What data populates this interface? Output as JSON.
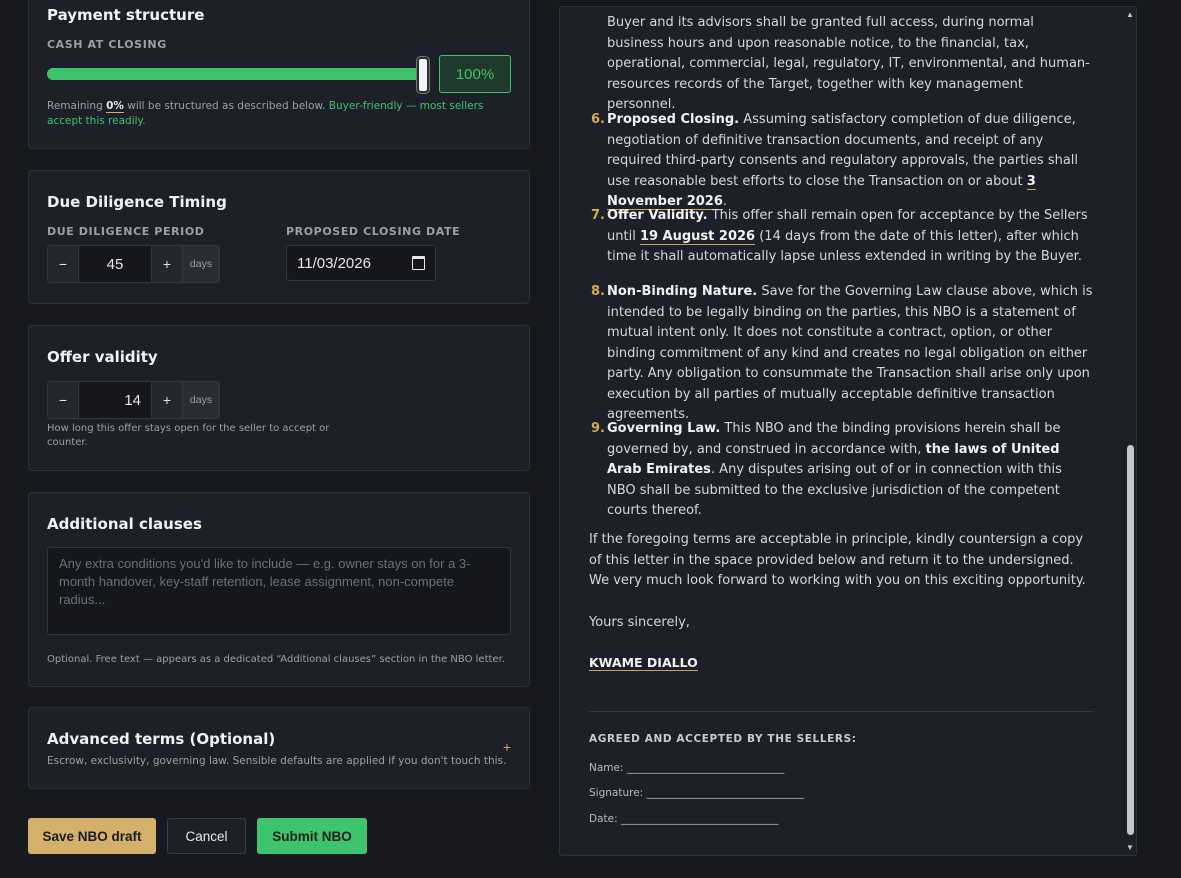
{
  "payment": {
    "title": "Payment structure",
    "cash_label": "CASH AT CLOSING",
    "cash_percent_display": "100%",
    "cash_percent": 100,
    "remaining_prefix": "Remaining ",
    "remaining_value": "0%",
    "remaining_suffix": " will be structured as described below. ",
    "remaining_hint": "Buyer-friendly — most sellers accept this readily."
  },
  "due_diligence": {
    "title": "Due Diligence Timing",
    "period_label": "DUE DILIGENCE PERIOD",
    "period_value": "45",
    "period_unit": "days",
    "minus": "−",
    "plus": "+",
    "closing_label": "PROPOSED CLOSING DATE",
    "closing_value": "11/03/2026"
  },
  "offer_validity": {
    "title": "Offer validity",
    "value": "14",
    "unit": "days",
    "minus": "−",
    "plus": "+",
    "help": "How long this offer stays open for the seller to accept or counter."
  },
  "additional": {
    "title": "Additional clauses",
    "placeholder": "Any extra conditions you'd like to include — e.g. owner stays on for a 3-month handover, key-staff retention, lease assignment, non-compete radius...",
    "help": "Optional. Free text — appears as a dedicated “Additional clauses” section in the NBO letter."
  },
  "advanced": {
    "title": "Advanced terms (Optional)",
    "subtitle": "Escrow, exclusivity, governing law. Sensible defaults are applied if you don't touch this.",
    "toggle": "+"
  },
  "actions": {
    "save": "Save NBO draft",
    "cancel": "Cancel",
    "submit": "Submit NBO"
  },
  "letter": {
    "top_text": "Buyer and its advisors shall be granted full access, during normal business hours and upon reasonable notice, to the financial, tax, operational, commercial, legal, regulatory, IT, environmental, and human-resources records of the Target, together with key management personnel.",
    "items": [
      {
        "num": "6.",
        "heading": "Proposed Closing.",
        "body_before": " Assuming satisfactory completion of due diligence, negotiation of definitive transaction documents, and receipt of any required third-party consents and regulatory approvals, the parties shall use reasonable best efforts to close the Transaction on or about ",
        "highlight": "3 November 2026",
        "body_after": "."
      },
      {
        "num": "7.",
        "heading": "Offer Validity.",
        "body_before": " This offer shall remain open for acceptance by the Sellers until ",
        "highlight": "19 August 2026",
        "body_after": " (14 days from the date of this letter), after which time it shall automatically lapse unless extended in writing by the Buyer."
      },
      {
        "num": "8.",
        "heading": "Non-Binding Nature.",
        "body_before": " Save for the Governing Law clause above, which is intended to be legally binding on the parties, this NBO is a statement of mutual intent only. It does not constitute a contract, option, or other binding commitment of any kind and creates no legal obligation on either party. Any obligation to consummate the Transaction shall arise only upon execution by all parties of mutually acceptable definitive transaction agreements.",
        "highlight": "",
        "body_after": ""
      },
      {
        "num": "9.",
        "heading": "Governing Law.",
        "body_before": " This NBO and the binding provisions herein shall be governed by, and construed in accordance with, ",
        "bold": "the laws of United Arab Emirates",
        "body_after": ". Any disputes arising out of or in connection with this NBO shall be submitted to the exclusive jurisdiction of the competent courts thereof."
      }
    ],
    "closing_para": "If the foregoing terms are acceptable in principle, kindly countersign a copy of this letter in the space provided below and return it to the undersigned. We very much look forward to working with you on this exciting opportunity.",
    "sign_off": "Yours sincerely,",
    "signatory": "KWAME DIALLO",
    "agreed_heading": "AGREED AND ACCEPTED BY THE SELLERS:",
    "name_line": "Name: ______________________________",
    "signature_line": "Signature: ______________________________",
    "date_line": "Date: ______________________________"
  }
}
